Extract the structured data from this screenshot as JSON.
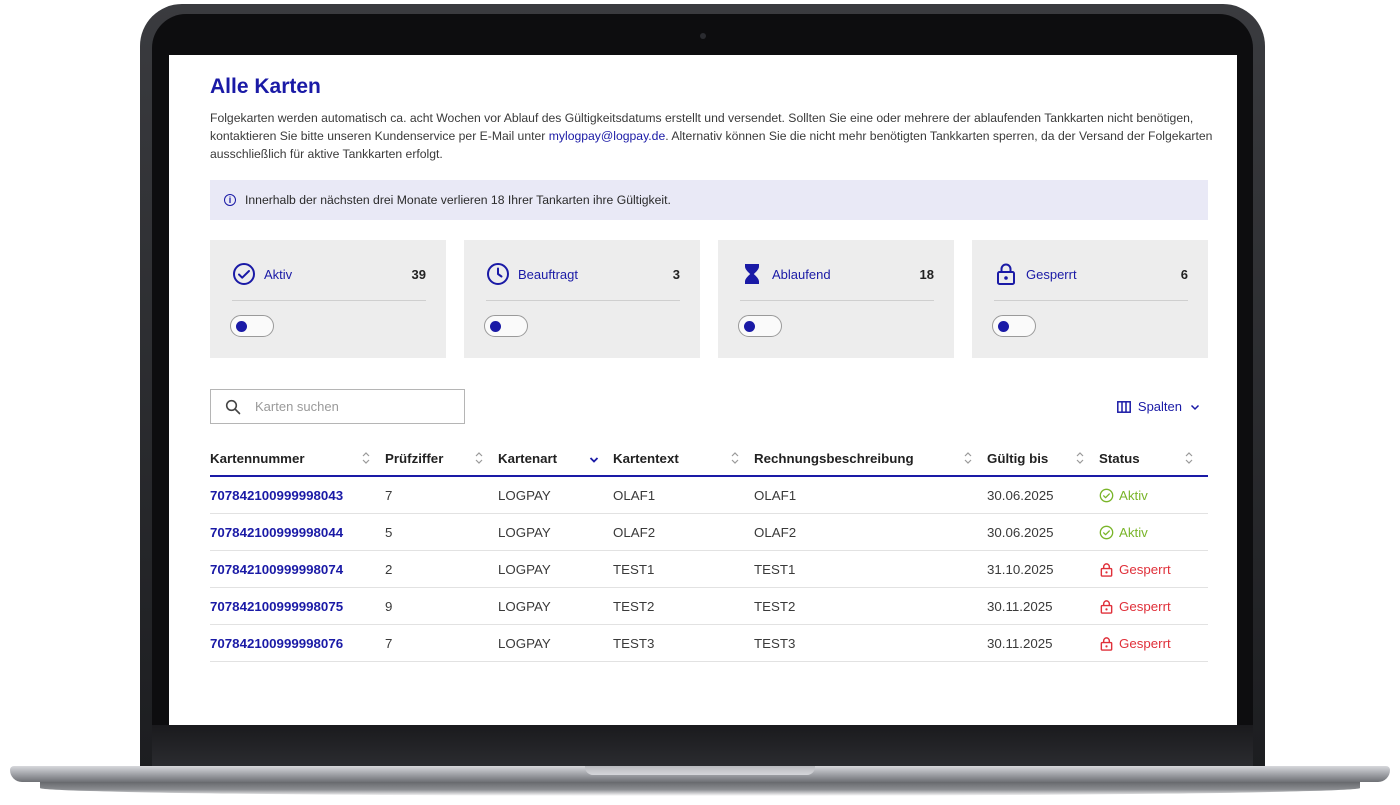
{
  "page": {
    "title": "Alle Karten",
    "intro_before_link": "Folgekarten werden automatisch ca. acht Wochen vor Ablauf des Gültigkeitsdatums erstellt und versendet. Sollten Sie eine oder mehrere der ablaufenden Tankkarten nicht benötigen, kontaktieren Sie bitte unseren Kundenservice per E-Mail unter ",
    "intro_link": "mylogpay@logpay.de",
    "intro_after_link": ". Alternativ können Sie die nicht mehr benötigten Tankkarten sperren, da der Versand der Folgekarten ausschließlich für aktive Tankkarten erfolgt."
  },
  "info_banner": {
    "icon": "info-icon",
    "text": "Innerhalb der nächsten drei Monate verlieren 18 Ihrer Tankarten ihre Gültigkeit."
  },
  "cards": [
    {
      "label": "Aktiv",
      "count": "39",
      "icon": "check-circle-icon",
      "toggle_on": false
    },
    {
      "label": "Beauftragt",
      "count": "3",
      "icon": "clock-icon",
      "toggle_on": false
    },
    {
      "label": "Ablaufend",
      "count": "18",
      "icon": "hourglass-icon",
      "toggle_on": false
    },
    {
      "label": "Gesperrt",
      "count": "6",
      "icon": "lock-icon",
      "toggle_on": false
    }
  ],
  "search": {
    "placeholder": "Karten suchen",
    "value": ""
  },
  "columns_button": {
    "label": "Spalten",
    "icon": "columns-icon"
  },
  "table": {
    "headers": [
      "Kartennummer",
      "Prüfziffer",
      "Kartenart",
      "Kartentext",
      "Rechnungsbeschreibung",
      "Gültig bis",
      "Status"
    ],
    "sorted_column": "Kartenart",
    "rows": [
      {
        "kartennummer": "707842100999998043",
        "pruefziffer": "7",
        "kartenart": "LOGPAY",
        "kartentext": "OLAF1",
        "rechnung": "OLAF1",
        "gueltig": "30.06.2025",
        "status": "Aktiv"
      },
      {
        "kartennummer": "707842100999998044",
        "pruefziffer": "5",
        "kartenart": "LOGPAY",
        "kartentext": "OLAF2",
        "rechnung": "OLAF2",
        "gueltig": "30.06.2025",
        "status": "Aktiv"
      },
      {
        "kartennummer": "707842100999998074",
        "pruefziffer": "2",
        "kartenart": "LOGPAY",
        "kartentext": "TEST1",
        "rechnung": "TEST1",
        "gueltig": "31.10.2025",
        "status": "Gesperrt"
      },
      {
        "kartennummer": "707842100999998075",
        "pruefziffer": "9",
        "kartenart": "LOGPAY",
        "kartentext": "TEST2",
        "rechnung": "TEST2",
        "gueltig": "30.11.2025",
        "status": "Gesperrt"
      },
      {
        "kartennummer": "707842100999998076",
        "pruefziffer": "7",
        "kartenart": "LOGPAY",
        "kartentext": "TEST3",
        "rechnung": "TEST3",
        "gueltig": "30.11.2025",
        "status": "Gesperrt"
      }
    ]
  },
  "colors": {
    "brand": "#1a1aa6",
    "aktiv": "#7ab52a",
    "gesperrt": "#e0303a",
    "banner_bg": "#e9e9f6",
    "card_bg": "#ededed"
  }
}
